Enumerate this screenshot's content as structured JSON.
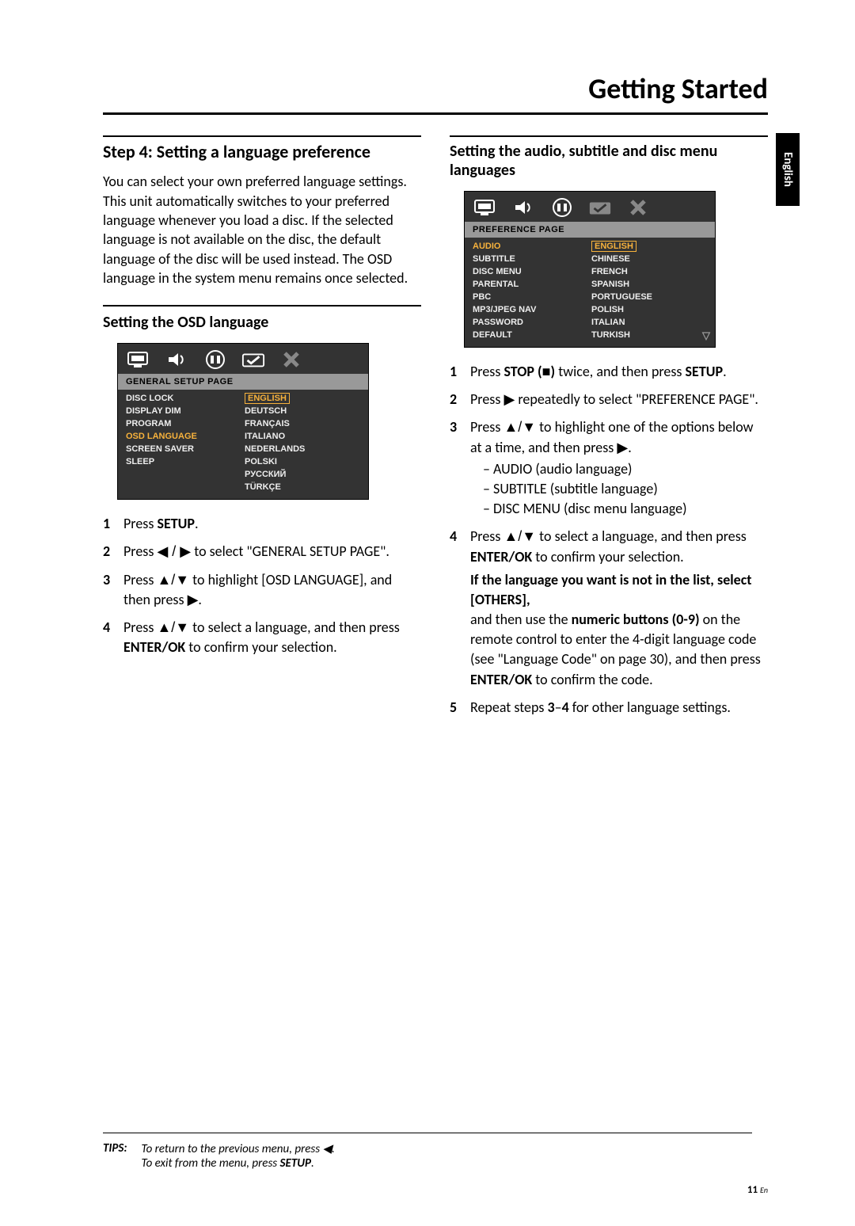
{
  "header": {
    "title": "Getting Started"
  },
  "sidetab": {
    "label": "English"
  },
  "left": {
    "step_heading": "Step 4: Setting a language preference",
    "intro": "You can select your own preferred language settings. This unit automatically switches to your preferred language whenever you load a disc. If the selected language is not available on the disc, the default language of the disc will be used instead. The OSD language in the system menu remains once selected.",
    "osd_heading": "Setting the OSD language",
    "menu1": {
      "title": "GENERAL SETUP PAGE",
      "left_items": [
        "DISC LOCK",
        "DISPLAY DIM",
        "PROGRAM",
        "OSD LANGUAGE",
        "SCREEN SAVER",
        "SLEEP"
      ],
      "highlight_left_index": 3,
      "right_items": [
        "ENGLISH",
        "DEUTSCH",
        "FRANÇAIS",
        "ITALIANO",
        "NEDERLANDS",
        "POLSKI",
        "РУССКИЙ",
        "TÜRKÇE"
      ],
      "highlight_right_index": 0
    },
    "steps": {
      "s1_a": "Press ",
      "s1_b": "SETUP",
      "s1_c": ".",
      "s2_a": "Press ",
      "s2_sym": "◀ / ▶",
      "s2_b": " to select \"GENERAL SETUP PAGE\".",
      "s3_a": "Press ",
      "s3_sym": "▲/▼",
      "s3_b": " to highlight [OSD LANGUAGE], and then press ",
      "s3_sym2": "▶",
      "s3_c": ".",
      "s4_a": "Press ",
      "s4_sym": "▲/▼",
      "s4_b": " to select a language, and then press ",
      "s4_bold": "ENTER/OK",
      "s4_c": " to confirm your selection."
    }
  },
  "right": {
    "heading": "Setting the audio, subtitle and disc menu languages",
    "menu2": {
      "title": "PREFERENCE PAGE",
      "left_items": [
        "AUDIO",
        "SUBTITLE",
        "DISC MENU",
        "PARENTAL",
        "PBC",
        "MP3/JPEG NAV",
        "PASSWORD",
        "DEFAULT"
      ],
      "highlight_left_index": 0,
      "right_items": [
        "ENGLISH",
        "CHINESE",
        "FRENCH",
        "SPANISH",
        "PORTUGUESE",
        "POLISH",
        "ITALIAN",
        "TURKISH"
      ],
      "highlight_right_index": 0
    },
    "steps": {
      "s1_a": "Press ",
      "s1_b1": "STOP (",
      "s1_sym": "■",
      "s1_b2": ")",
      "s1_c": " twice, and then press ",
      "s1_d": "SETUP",
      "s1_e": ".",
      "s2_a": "Press ",
      "s2_sym": "▶",
      "s2_b": " repeatedly to select \"PREFERENCE PAGE\".",
      "s3_a": "Press ",
      "s3_sym": "▲/▼",
      "s3_b": " to highlight one of the options below at a time, and then press ",
      "s3_sym2": "▶",
      "s3_c": ".",
      "s3_list": [
        "AUDIO (audio language)",
        "SUBTITLE (subtitle language)",
        "DISC MENU (disc menu language)"
      ],
      "s4_a": "Press ",
      "s4_sym": "▲/▼",
      "s4_b": " to select a language, and then press ",
      "s4_bold": "ENTER/OK",
      "s4_c": " to confirm your selection.",
      "note_bold": "If the language you want is not in the list, select [OTHERS],",
      "note_a": "and then use the ",
      "note_b": "numeric buttons (0-9)",
      "note_c": " on the remote control to enter the 4-digit language code (see \"Language Code\" on page 30), and then press ",
      "note_d": "ENTER/OK",
      "note_e": " to confirm the code.",
      "s5_a": "Repeat steps ",
      "s5_b": "3",
      "s5_c": "–",
      "s5_d": "4",
      "s5_e": " for other language settings."
    }
  },
  "tips": {
    "label": "TIPS:",
    "line1_a": "To return to the previous menu, press ",
    "line1_sym": "◀",
    "line1_b": ".",
    "line2_a": "To exit from the menu, press ",
    "line2_b": "SETUP",
    "line2_c": "."
  },
  "footer": {
    "pagenum": "11",
    "lang": "En"
  }
}
